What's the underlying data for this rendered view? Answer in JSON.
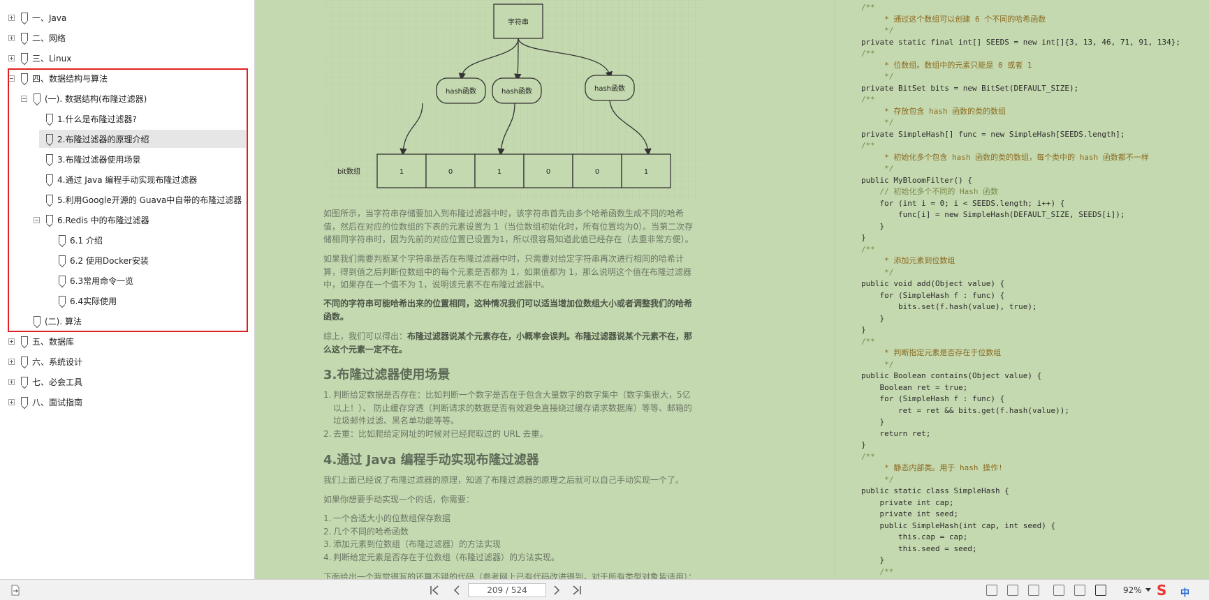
{
  "sidebar": {
    "items": [
      {
        "label": "一、Java",
        "toggle": "plus"
      },
      {
        "label": "二、网络",
        "toggle": "plus"
      },
      {
        "label": "三、Linux",
        "toggle": "plus"
      },
      {
        "label": "四、数据结构与算法",
        "toggle": "minus"
      },
      {
        "label": "(一). 数据结构(布隆过滤器)",
        "toggle": "minus"
      },
      {
        "label": "1.什么是布隆过滤器?",
        "toggle": "none"
      },
      {
        "label": "2.布隆过滤器的原理介绍",
        "toggle": "none",
        "selected": true
      },
      {
        "label": "3.布隆过滤器使用场景",
        "toggle": "none"
      },
      {
        "label": "4.通过 Java 编程手动实现布隆过滤器",
        "toggle": "none"
      },
      {
        "label": "5.利用Google开源的 Guava中自带的布隆过滤器",
        "toggle": "none"
      },
      {
        "label": "6.Redis 中的布隆过滤器",
        "toggle": "minus"
      },
      {
        "label": "6.1 介绍",
        "toggle": "none"
      },
      {
        "label": "6.2 使用Docker安装",
        "toggle": "none"
      },
      {
        "label": "6.3常用命令一览",
        "toggle": "none"
      },
      {
        "label": "6.4实际使用",
        "toggle": "none"
      },
      {
        "label": "(二). 算法",
        "toggle": "none"
      },
      {
        "label": "五、数据库",
        "toggle": "plus"
      },
      {
        "label": "六、系统设计",
        "toggle": "plus"
      },
      {
        "label": "七、必会工具",
        "toggle": "plus"
      },
      {
        "label": "八、面试指南",
        "toggle": "plus"
      }
    ]
  },
  "diagram": {
    "root": "字符串",
    "hash_nodes": [
      "hash函数",
      "hash函数",
      "hash函数"
    ],
    "bit_label": "bit数组",
    "bits": [
      "1",
      "0",
      "1",
      "0",
      "0",
      "1"
    ]
  },
  "content": {
    "p1": "如图所示，当字符串存储要加入到布隆过滤器中时，该字符串首先由多个哈希函数生成不同的哈希值，然后在对应的位数组的下表的元素设置为 1（当位数组初始化时，所有位置均为0）。当第二次存储相同字符串时，因为先前的对应位置已设置为1，所以很容易知道此值已经存在（去重非常方便）。",
    "p2": "如果我们需要判断某个字符串是否在布隆过滤器中时，只需要对给定字符串再次进行相同的哈希计算，得到值之后判断位数组中的每个元素是否都为 1，如果值都为 1，那么说明这个值在布隆过滤器中，如果存在一个值不为 1，说明该元素不在布隆过滤器中。",
    "p3": "不同的字符串可能哈希出来的位置相同，这种情况我们可以适当增加位数组大小或者调整我们的哈希函数。",
    "p4_pre": "综上，我们可以得出：",
    "p4_bold": "布隆过滤器说某个元素存在，小概率会误判。布隆过滤器说某个元素不在，那么这个元素一定不在。",
    "h3": "3.布隆过滤器使用场景",
    "list1": [
      "判断给定数据是否存在：比如判断一个数字是否在于包含大量数字的数字集中（数字集很大，5亿以上！）、 防止缓存穿透（判断请求的数据是否有效避免直接绕过缓存请求数据库）等等、邮箱的垃圾邮件过滤、黑名单功能等等。",
      "去重：比如爬给定网址的时候对已经爬取过的 URL 去重。"
    ],
    "h4": "4.通过 Java 编程手动实现布隆过滤器",
    "p5": "我们上面已经说了布隆过滤器的原理，知道了布隆过滤器的原理之后就可以自己手动实现一个了。",
    "p6": "如果你想要手动实现一个的话，你需要：",
    "list2": [
      "一个合适大小的位数组保存数据",
      "几个不同的哈希函数",
      "添加元素到位数组（布隆过滤器）的方法实现",
      "判断给定元素是否存在于位数组（布隆过滤器）的方法实现。"
    ],
    "p7": "下面给出一个我觉得写的还算不错的代码（参考网上已有代码改进得到，对于所有类型对象皆适用）："
  },
  "code": {
    "lines": [
      "/**",
      "     * 通过这个数组可以创建 6 个不同的哈希函数",
      "     */",
      "private static final int[] SEEDS = new int[]{3, 13, 46, 71, 91, 134};",
      "/**",
      "     * 位数组。数组中的元素只能是 0 或者 1",
      "     */",
      "private BitSet bits = new BitSet(DEFAULT_SIZE);",
      "/**",
      "     * 存放包含 hash 函数的类的数组",
      "     */",
      "private SimpleHash[] func = new SimpleHash[SEEDS.length];",
      "/**",
      "     * 初始化多个包含 hash 函数的类的数组，每个类中的 hash 函数都不一样",
      "     */",
      "public MyBloomFilter() {",
      "    // 初始化多个不同的 Hash 函数",
      "    for (int i = 0; i < SEEDS.length; i++) {",
      "        func[i] = new SimpleHash(DEFAULT_SIZE, SEEDS[i]);",
      "    }",
      "}",
      "/**",
      "     * 添加元素到位数组",
      "     */",
      "public void add(Object value) {",
      "    for (SimpleHash f : func) {",
      "        bits.set(f.hash(value), true);",
      "    }",
      "}",
      "/**",
      "     * 判断指定元素是否存在于位数组",
      "     */",
      "public Boolean contains(Object value) {",
      "    Boolean ret = true;",
      "    for (SimpleHash f : func) {",
      "        ret = ret && bits.get(f.hash(value));",
      "    }",
      "    return ret;",
      "}",
      "/**",
      "     * 静态内部类。用于 hash 操作!",
      "     */",
      "public static class SimpleHash {",
      "    private int cap;",
      "    private int seed;",
      "    public SimpleHash(int cap, int seed) {",
      "        this.cap = cap;",
      "        this.seed = seed;",
      "    }",
      "    /**"
    ]
  },
  "bottom_bar": {
    "page_indicator": "209 / 524",
    "zoom": "92%",
    "ime": "中"
  },
  "colors": {
    "page_bg": "#c5d9b0",
    "highlight": "#e02020",
    "keyword": "#1a2fa0"
  }
}
